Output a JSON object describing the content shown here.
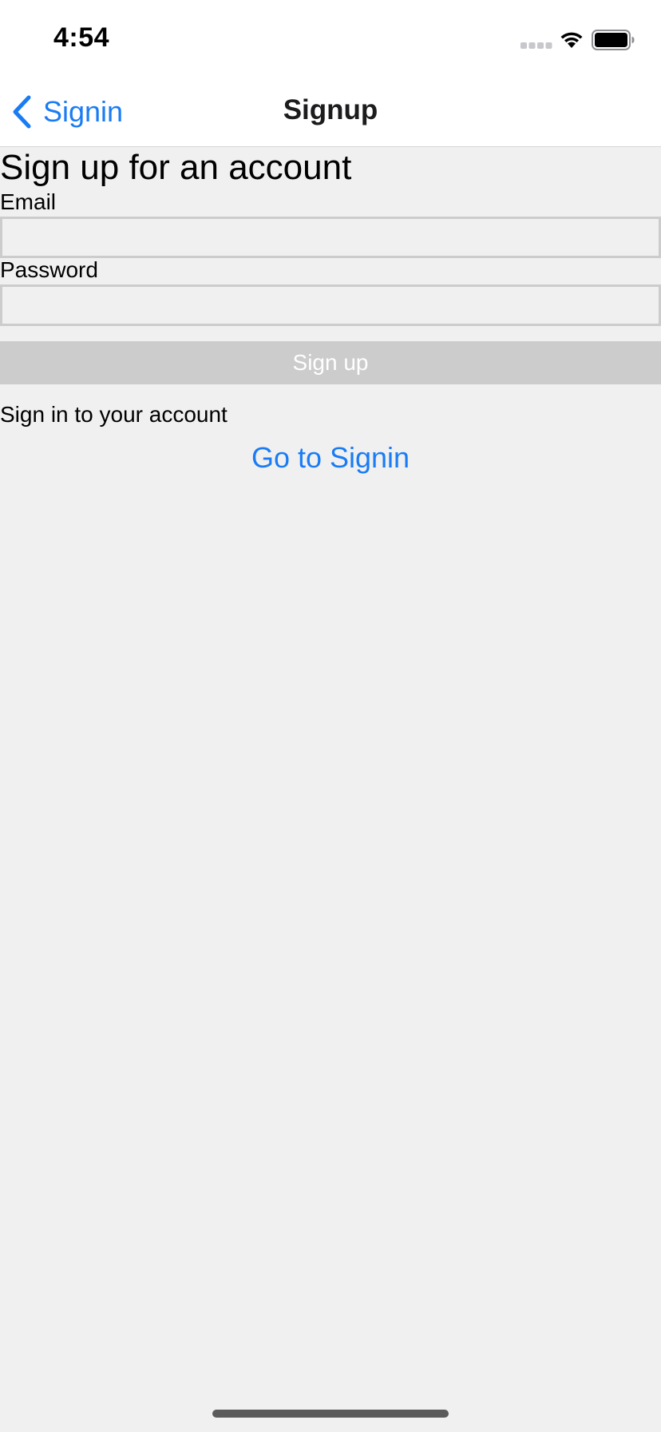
{
  "status_bar": {
    "time": "4:54"
  },
  "nav": {
    "back_label": "Signin",
    "title": "Signup"
  },
  "form": {
    "heading": "Sign up for an account",
    "email_label": "Email",
    "email_value": "",
    "password_label": "Password",
    "password_value": "",
    "submit_label": "Sign up",
    "signin_prompt": "Sign in to your account",
    "signin_link": "Go to Signin"
  },
  "colors": {
    "accent": "#1a7cf4",
    "background": "#f0f0f0",
    "button_disabled": "#cccccc"
  }
}
